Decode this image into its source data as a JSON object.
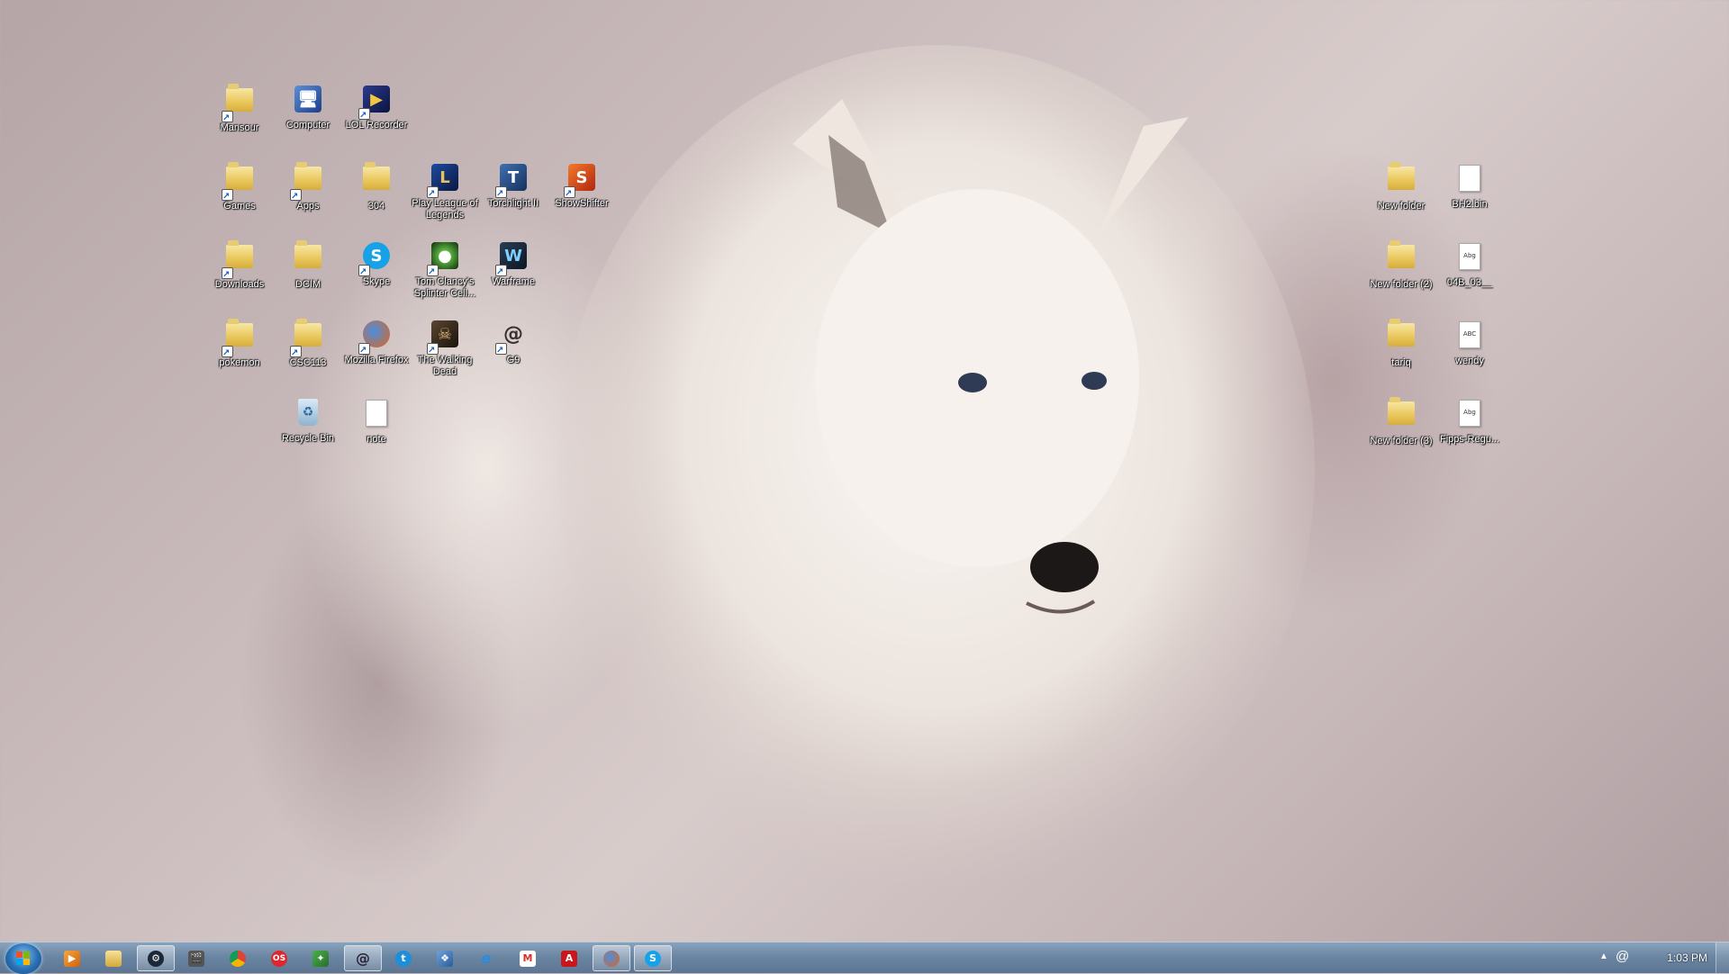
{
  "desktop": {
    "icons_left": [
      {
        "label": "Mansour",
        "kind": "user-folder-icon"
      },
      {
        "label": "Computer",
        "kind": "computer-icon"
      },
      {
        "label": "LOL Recorder",
        "kind": "lol-recorder-icon"
      },
      {
        "label": "Games",
        "kind": "folder-icon"
      },
      {
        "label": "Apps",
        "kind": "folder-icon"
      },
      {
        "label": "304",
        "kind": "folder-icon"
      },
      {
        "label": "Play League of Legends",
        "kind": "league-icon"
      },
      {
        "label": "Torchlight II",
        "kind": "torchlight-icon"
      },
      {
        "label": "ShowShifter",
        "kind": "showshifter-icon"
      },
      {
        "label": "Downloads",
        "kind": "folder-icon"
      },
      {
        "label": "DCIM",
        "kind": "folder-icon"
      },
      {
        "label": "Skype",
        "kind": "skype-icon"
      },
      {
        "label": "Tom Clancy's Splinter Cell...",
        "kind": "splinter-cell-icon"
      },
      {
        "label": "Warframe",
        "kind": "warframe-icon"
      },
      {
        "label": "pokemon",
        "kind": "folder-icon"
      },
      {
        "label": "CSC113",
        "kind": "folder-icon"
      },
      {
        "label": "Mozilla Firefox",
        "kind": "firefox-icon"
      },
      {
        "label": "The Walking Dead",
        "kind": "walking-dead-icon"
      },
      {
        "label": "G9",
        "kind": "g9-icon"
      },
      {
        "label": "Recycle Bin",
        "kind": "recycle-bin-icon"
      },
      {
        "label": "note",
        "kind": "text-file-icon"
      }
    ],
    "icons_right": [
      {
        "label": "New folder",
        "kind": "folder-icon"
      },
      {
        "label": "BH2.bin",
        "kind": "file-icon"
      },
      {
        "label": "New folder (2)",
        "kind": "folder-icon"
      },
      {
        "label": "04B_03__",
        "kind": "font-file-icon"
      },
      {
        "label": "tariq",
        "kind": "folder-icon"
      },
      {
        "label": "wendy",
        "kind": "font-file-icon"
      },
      {
        "label": "New folder (3)",
        "kind": "folder-icon"
      },
      {
        "label": "Fipps-Regu...",
        "kind": "font-file-icon"
      }
    ]
  },
  "taskbar": {
    "pinned": [
      {
        "name": "media-player-icon",
        "active": false
      },
      {
        "name": "explorer-icon",
        "active": false
      },
      {
        "name": "steam-icon",
        "active": true
      },
      {
        "name": "movie-maker-icon",
        "active": false
      },
      {
        "name": "chrome-icon",
        "active": false
      },
      {
        "name": "opera-icon",
        "active": false
      },
      {
        "name": "paint-icon",
        "active": false
      },
      {
        "name": "g9-icon",
        "active": true
      },
      {
        "name": "utorrent-icon",
        "active": false
      },
      {
        "name": "app-icon",
        "active": false
      },
      {
        "name": "internet-explorer-icon",
        "active": false
      },
      {
        "name": "gmail-icon",
        "active": false
      },
      {
        "name": "acrobat-icon",
        "active": false
      },
      {
        "name": "firefox-icon",
        "active": true
      },
      {
        "name": "skype-icon",
        "active": true
      }
    ],
    "clock": "1:03 PM"
  }
}
